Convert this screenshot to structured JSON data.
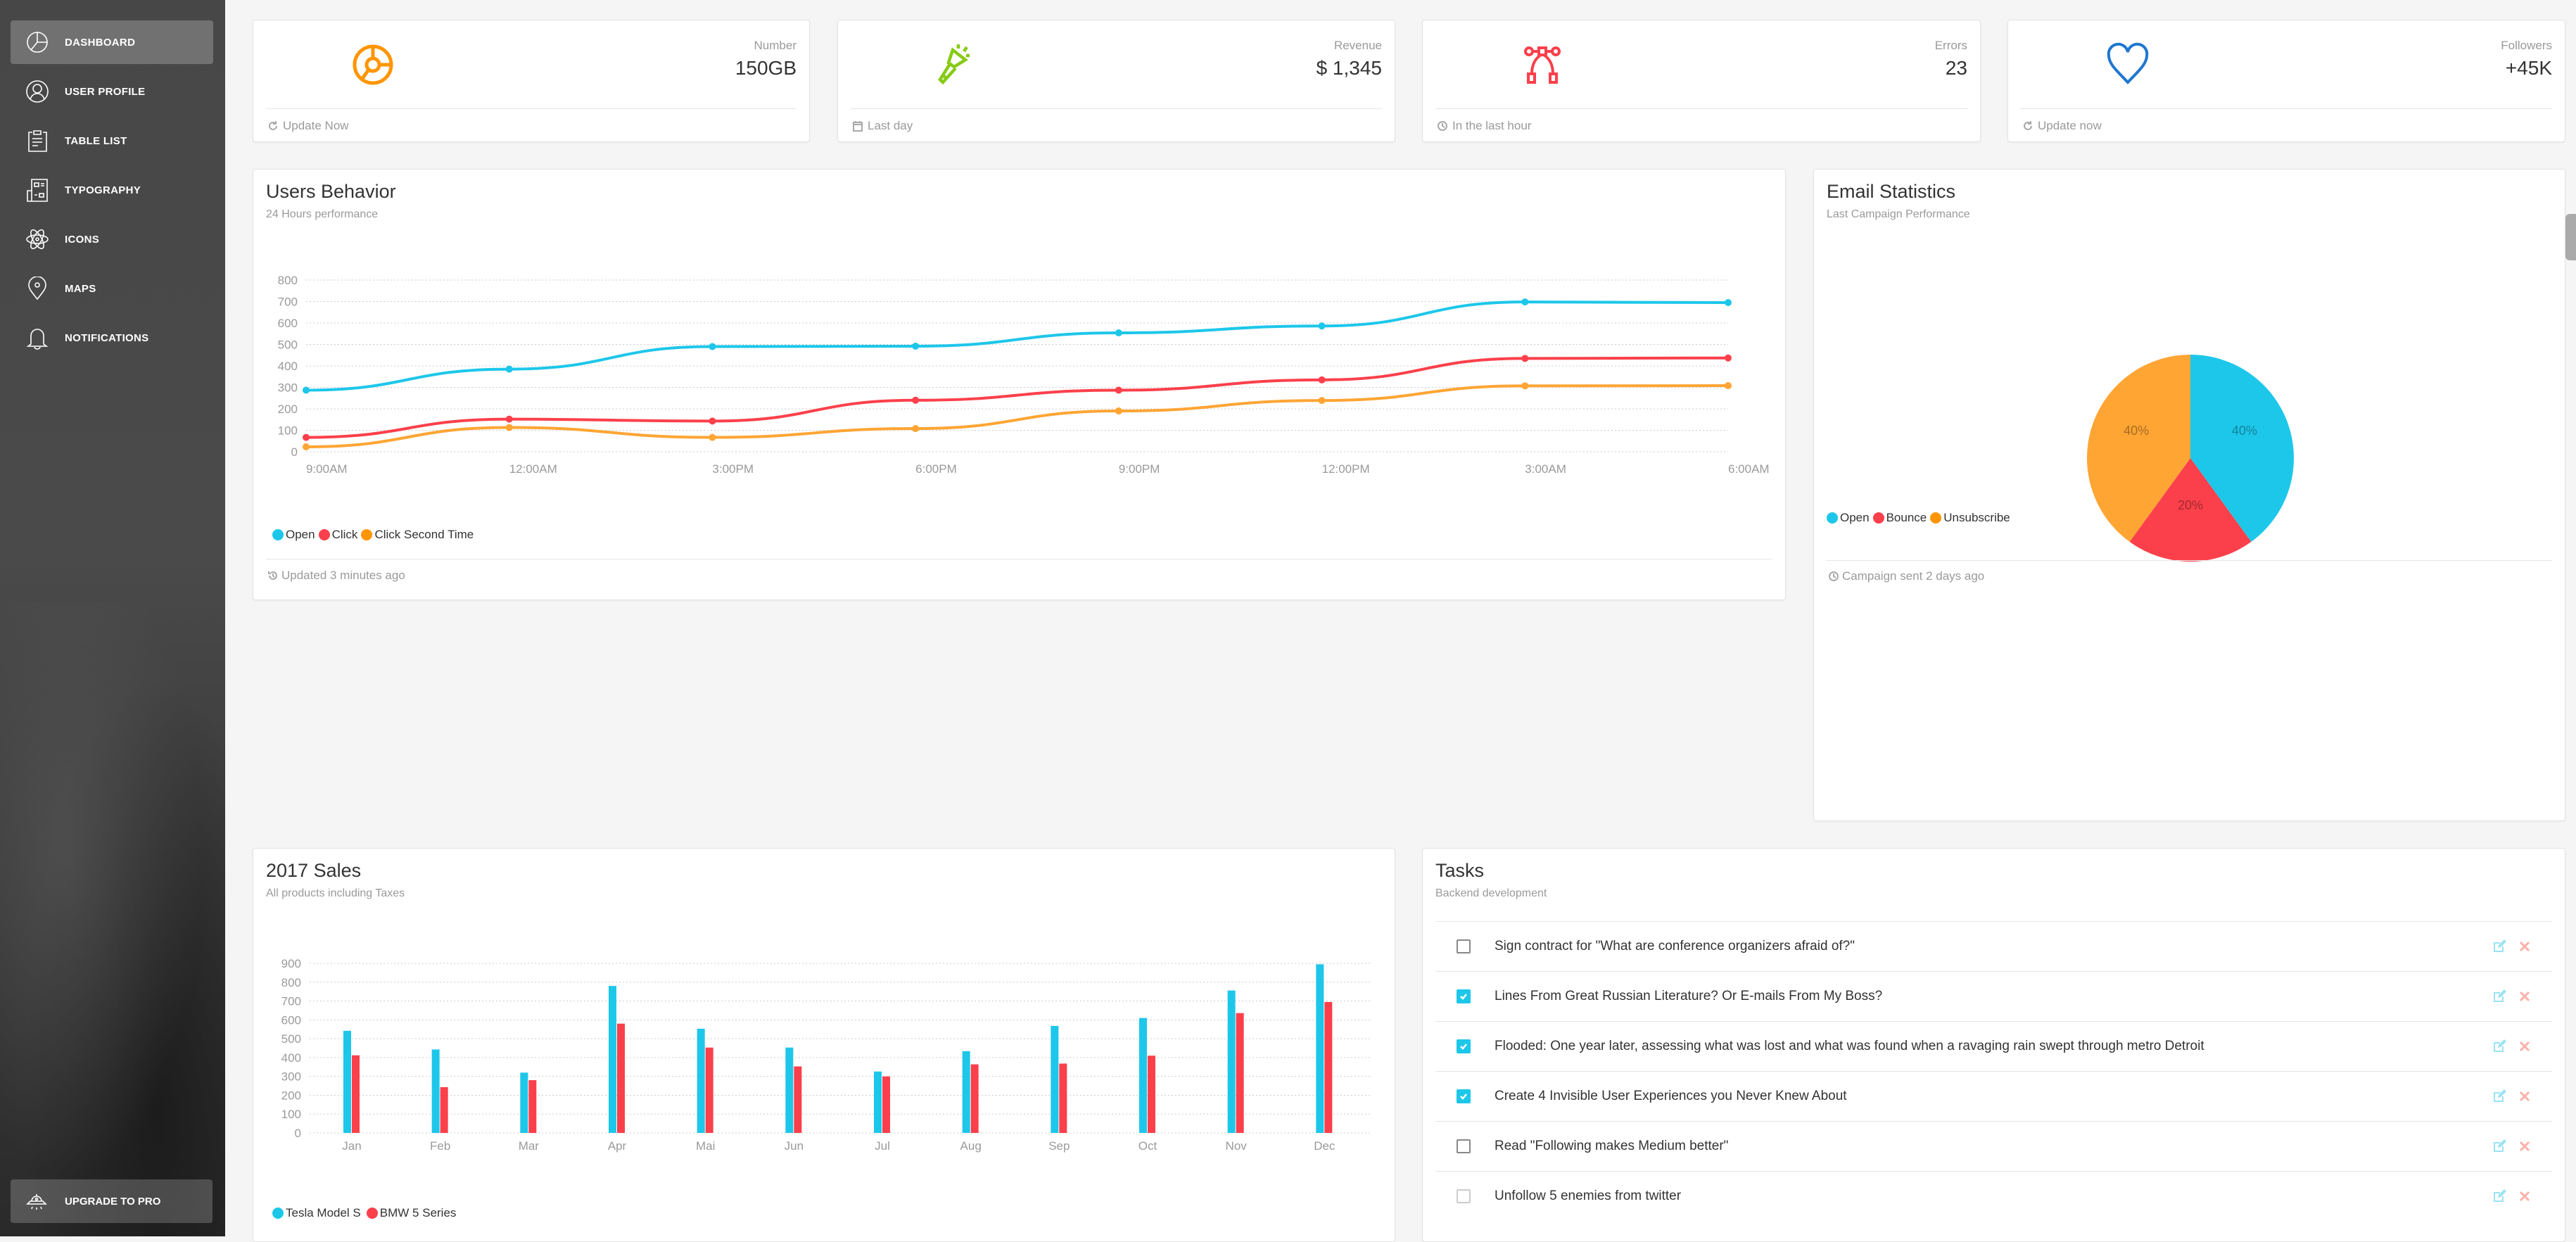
{
  "sidebar": {
    "items": [
      {
        "label": "DASHBOARD",
        "icon": "chart-pie-icon",
        "active": true
      },
      {
        "label": "USER PROFILE",
        "icon": "user-icon",
        "active": false
      },
      {
        "label": "TABLE LIST",
        "icon": "clipboard-icon",
        "active": false
      },
      {
        "label": "TYPOGRAPHY",
        "icon": "newspaper-icon",
        "active": false
      },
      {
        "label": "ICONS",
        "icon": "atom-icon",
        "active": false
      },
      {
        "label": "MAPS",
        "icon": "map-pin-icon",
        "active": false
      },
      {
        "label": "NOTIFICATIONS",
        "icon": "bell-icon",
        "active": false
      }
    ],
    "upgrade": {
      "label": "UPGRADE TO PRO",
      "icon": "alien-ship-icon"
    }
  },
  "stats": [
    {
      "label": "Number",
      "value": "150GB",
      "footer": "Update Now",
      "icon": "chart-icon",
      "footer_icon": "refresh-icon",
      "color": "#ff9500"
    },
    {
      "label": "Revenue",
      "value": "$ 1,345",
      "footer": "Last day",
      "icon": "flashlight-icon",
      "footer_icon": "calendar-icon",
      "color": "#87cb16"
    },
    {
      "label": "Errors",
      "value": "23",
      "footer": "In the last hour",
      "icon": "vector-icon",
      "footer_icon": "clock-icon",
      "color": "#fb404b"
    },
    {
      "label": "Followers",
      "value": "+45K",
      "footer": "Update now",
      "icon": "heart-icon",
      "footer_icon": "refresh-icon",
      "color": "#1f77d0"
    }
  ],
  "users_behavior": {
    "title": "Users Behavior",
    "subtitle": "24 Hours performance",
    "footer": "Updated 3 minutes ago"
  },
  "email_stats": {
    "title": "Email Statistics",
    "subtitle": "Last Campaign Performance",
    "footer": "Campaign sent 2 days ago"
  },
  "sales": {
    "title": "2017 Sales",
    "subtitle": "All products including Taxes"
  },
  "tasks": {
    "title": "Tasks",
    "subtitle": "Backend development",
    "items": [
      {
        "text": "Sign contract for \"What are conference organizers afraid of?\"",
        "checked": false
      },
      {
        "text": "Lines From Great Russian Literature? Or E-mails From My Boss?",
        "checked": true
      },
      {
        "text": "Flooded: One year later, assessing what was lost and what was found when a ravaging rain swept through metro Detroit",
        "checked": true
      },
      {
        "text": "Create 4 Invisible User Experiences you Never Knew About",
        "checked": true
      },
      {
        "text": "Read \"Following makes Medium better\"",
        "checked": false
      },
      {
        "text": "Unfollow 5 enemies from twitter",
        "checked": false,
        "disabled": true
      }
    ]
  },
  "colors": {
    "cyan": "#1dc7ea",
    "red": "#fb404b",
    "orange": "#ffa534",
    "edit": "#1dc7ea",
    "remove": "#fb404b"
  },
  "chart_data": [
    {
      "type": "line",
      "title": "Users Behavior",
      "categories": [
        "9:00AM",
        "12:00AM",
        "3:00PM",
        "6:00PM",
        "9:00PM",
        "12:00PM",
        "3:00AM",
        "6:00AM"
      ],
      "series": [
        {
          "name": "Open",
          "color": "#1dc7ea",
          "values": [
            287,
            385,
            490,
            492,
            554,
            586,
            698,
            695
          ]
        },
        {
          "name": "Click",
          "color": "#fb404b",
          "values": [
            67,
            152,
            143,
            240,
            287,
            335,
            435,
            437
          ]
        },
        {
          "name": "Click Second Time",
          "color": "#ffa534",
          "values": [
            23,
            113,
            67,
            108,
            190,
            239,
            307,
            308
          ]
        }
      ],
      "yticks": [
        0,
        100,
        200,
        300,
        400,
        500,
        600,
        700,
        800
      ],
      "ylim": [
        0,
        800
      ],
      "grid": true,
      "legend": "bottom-left"
    },
    {
      "type": "pie",
      "title": "Email Statistics",
      "labels": [
        "Open",
        "Bounce",
        "Unsubscribe"
      ],
      "values": [
        40,
        20,
        40
      ],
      "value_labels": [
        "40%",
        "20%",
        "40%"
      ],
      "colors": [
        "#1dc7ea",
        "#fb404b",
        "#ffa534"
      ],
      "legend": "bottom-left"
    },
    {
      "type": "bar",
      "title": "2017 Sales",
      "categories": [
        "Jan",
        "Feb",
        "Mar",
        "Apr",
        "Mai",
        "Jun",
        "Jul",
        "Aug",
        "Sep",
        "Oct",
        "Nov",
        "Dec"
      ],
      "series": [
        {
          "name": "Tesla Model S",
          "color": "#1dc7ea",
          "values": [
            542,
            443,
            320,
            780,
            553,
            453,
            326,
            434,
            568,
            610,
            756,
            895
          ]
        },
        {
          "name": "BMW 5 Series",
          "color": "#fb404b",
          "values": [
            412,
            243,
            280,
            580,
            453,
            353,
            300,
            364,
            368,
            410,
            636,
            695
          ]
        }
      ],
      "yticks": [
        0,
        100,
        200,
        300,
        400,
        500,
        600,
        700,
        800,
        900
      ],
      "ylim": [
        0,
        900
      ],
      "grid": true,
      "legend": "bottom-left"
    }
  ]
}
